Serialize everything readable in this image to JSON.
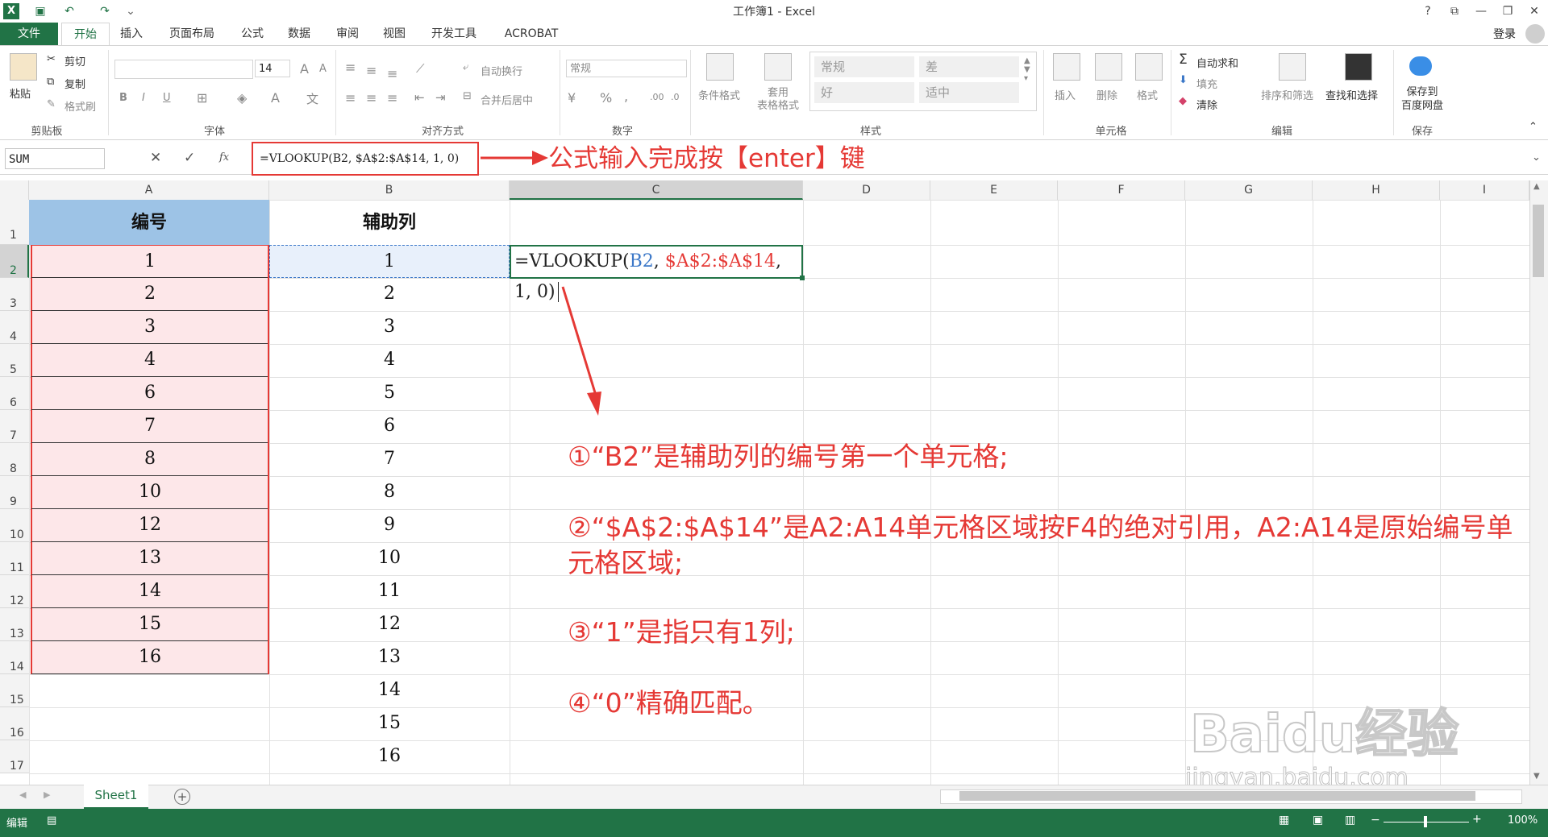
{
  "title": "工作簿1 - Excel",
  "titlebar": {
    "help": "?",
    "ribbon_opts": "⧉",
    "minimize": "—",
    "restore": "❐",
    "close": "✕",
    "login": "登录"
  },
  "tabs": [
    "文件",
    "开始",
    "插入",
    "页面布局",
    "公式",
    "数据",
    "审阅",
    "视图",
    "开发工具",
    "ACROBAT"
  ],
  "ribbon": {
    "clipboard": {
      "paste": "粘贴",
      "cut": "剪切",
      "copy": "复制",
      "format_painter": "格式刷",
      "label": "剪贴板"
    },
    "font": {
      "size": "14",
      "bold": "B",
      "italic": "I",
      "underline": "U",
      "grow": "A",
      "shrink": "A",
      "wen": "文",
      "label": "字体"
    },
    "alignment": {
      "wrap": "自动换行",
      "merge": "合并后居中",
      "label": "对齐方式"
    },
    "number": {
      "format": "常规",
      "percent": "%",
      "comma": ",",
      "label": "数字"
    },
    "styles": {
      "conditional": "条件格式",
      "table": "套用\n表格格式",
      "normal": "常规",
      "bad": "差",
      "good": "好",
      "neutral": "适中",
      "label": "样式"
    },
    "cells": {
      "insert": "插入",
      "delete": "删除",
      "format": "格式",
      "label": "单元格"
    },
    "editing": {
      "autosum": "自动求和",
      "fill": "填充",
      "clear": "清除",
      "sort": "排序和筛选",
      "find": "查找和选择",
      "label": "编辑"
    },
    "save": {
      "button": "保存到\n百度网盘",
      "label": "保存"
    }
  },
  "formula_bar": {
    "name_box": "SUM",
    "cancel": "✕",
    "enter": "✓",
    "fx": "fx",
    "formula": "=VLOOKUP(B2, $A$2:$A$14, 1, 0)",
    "note": "公式输入完成按【enter】键"
  },
  "columns": [
    "A",
    "B",
    "C",
    "D",
    "E",
    "F",
    "G",
    "H",
    "I"
  ],
  "rows": [
    "1",
    "2",
    "3",
    "4",
    "5",
    "6",
    "7",
    "8",
    "9",
    "10",
    "11",
    "12",
    "13",
    "14",
    "15",
    "16",
    "17"
  ],
  "sheet": {
    "a_header": "编号",
    "b_header": "辅助列",
    "a_values": [
      "1",
      "2",
      "3",
      "4",
      "6",
      "7",
      "8",
      "10",
      "12",
      "13",
      "14",
      "15",
      "16"
    ],
    "b_values": [
      "1",
      "2",
      "3",
      "4",
      "5",
      "6",
      "7",
      "8",
      "9",
      "10",
      "11",
      "12",
      "13",
      "14",
      "15",
      "16"
    ],
    "c2": {
      "prefix": "=VLOOKUP(",
      "ref1": "B2",
      "sep1": ", ",
      "ref2": "$A$2:$A$14",
      "rest": ", 1, 0)"
    }
  },
  "annotations": [
    "①“B2”是辅助列的编号第一个单元格;",
    "②“$A$2:$A$14”是A2:A14单元格区域按F4的绝对引用，A2:A14是原始编号单",
    "元格区域;",
    "③“1”是指只有1列;",
    "④“0”精确匹配。"
  ],
  "sheet_tab": "Sheet1",
  "status": {
    "mode": "编辑",
    "zoom": "100%"
  },
  "watermark": {
    "brand": "Baidu经验",
    "url": "jingyan.baidu.com"
  },
  "colors": {
    "excel_green": "#217346",
    "annotation_red": "#e53935",
    "col_a_fill": "#fde7e9",
    "header_fill": "#9dc3e6"
  }
}
